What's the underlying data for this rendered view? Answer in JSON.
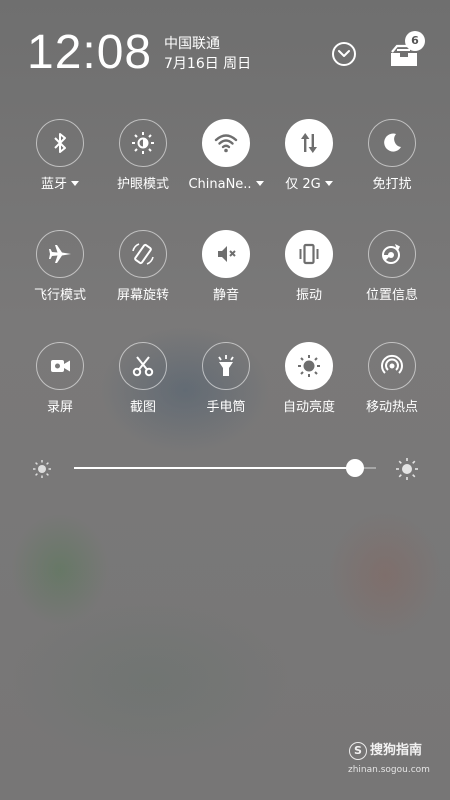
{
  "status": {
    "time": "12:08",
    "carrier": "中国联通",
    "date": "7月16日 周日",
    "notification_count": "6"
  },
  "toggles": [
    {
      "label": "蓝牙",
      "icon": "bluetooth-icon",
      "active": false,
      "dropdown": true
    },
    {
      "label": "护眼模式",
      "icon": "eye-care-icon",
      "active": false,
      "dropdown": false
    },
    {
      "label": "ChinaNe..",
      "icon": "wifi-icon",
      "active": true,
      "dropdown": true
    },
    {
      "label": "仅 2G",
      "icon": "mobile-data-icon",
      "active": true,
      "dropdown": true
    },
    {
      "label": "免打扰",
      "icon": "moon-icon",
      "active": false,
      "dropdown": false
    },
    {
      "label": "飞行模式",
      "icon": "airplane-icon",
      "active": false,
      "dropdown": false
    },
    {
      "label": "屏幕旋转",
      "icon": "rotate-icon",
      "active": false,
      "dropdown": false
    },
    {
      "label": "静音",
      "icon": "mute-icon",
      "active": true,
      "dropdown": false
    },
    {
      "label": "振动",
      "icon": "vibrate-icon",
      "active": true,
      "dropdown": false
    },
    {
      "label": "位置信息",
      "icon": "location-icon",
      "active": false,
      "dropdown": false
    },
    {
      "label": "录屏",
      "icon": "screen-record-icon",
      "active": false,
      "dropdown": false
    },
    {
      "label": "截图",
      "icon": "scissors-icon",
      "active": false,
      "dropdown": false
    },
    {
      "label": "手电筒",
      "icon": "flashlight-icon",
      "active": false,
      "dropdown": false
    },
    {
      "label": "自动亮度",
      "icon": "auto-brightness-icon",
      "active": true,
      "dropdown": false
    },
    {
      "label": "移动热点",
      "icon": "hotspot-icon",
      "active": false,
      "dropdown": false
    }
  ],
  "brightness": {
    "level": 0.93
  },
  "watermark": {
    "name": "搜狗指南",
    "url": "zhinan.sogou.com",
    "logo_letter": "S"
  },
  "colors": {
    "active_circle": "#ffffff",
    "active_icon": "#6e6e6e",
    "background": "#777676"
  }
}
